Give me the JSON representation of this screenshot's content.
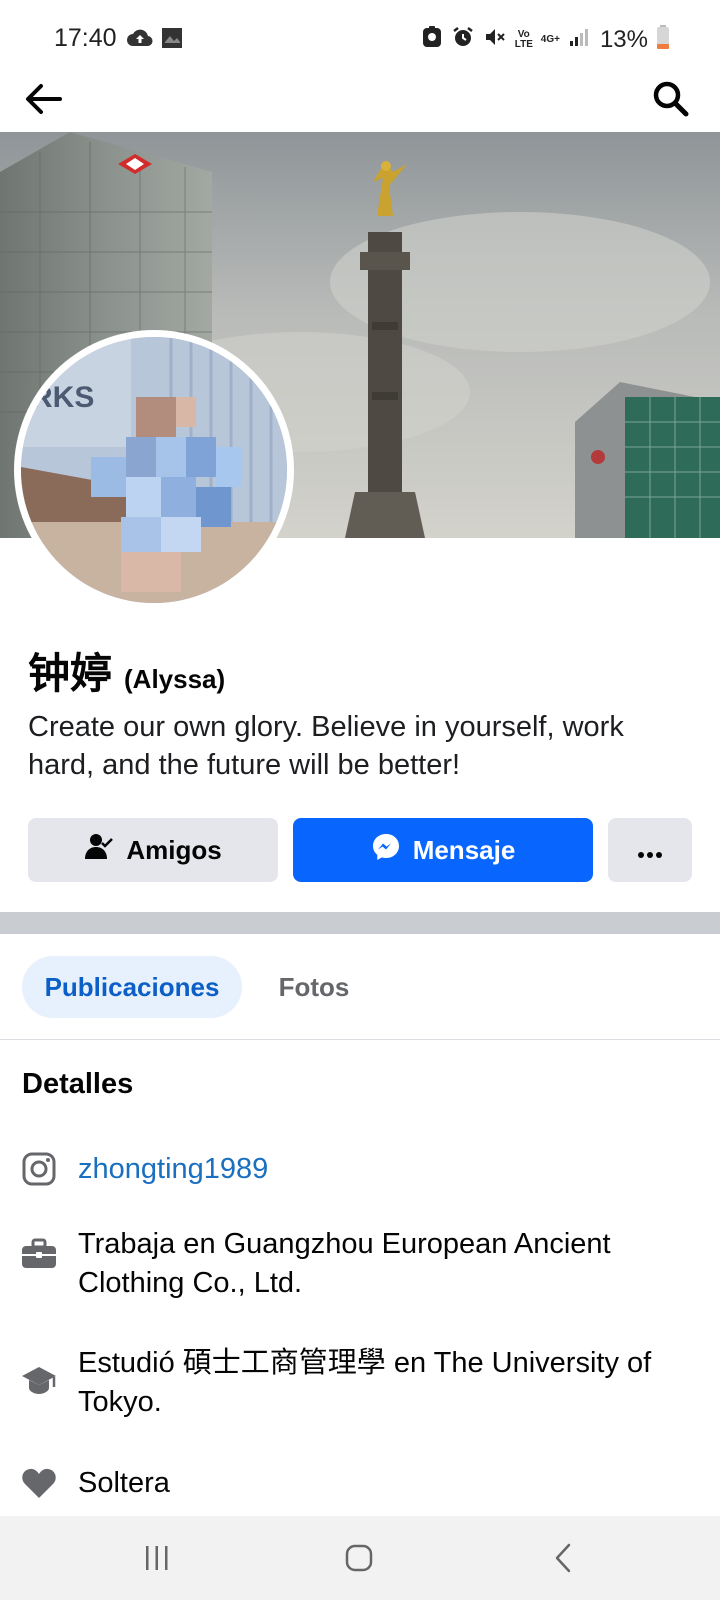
{
  "status_bar": {
    "time": "17:40",
    "battery_percent": "13%",
    "volte_label": "Vo LTE",
    "network_label": "4G+",
    "left_icons": [
      "cloud-upload-icon",
      "photo-icon"
    ],
    "right_icons": [
      "app-notification-icon",
      "alarm-icon",
      "mute-icon",
      "volte-icon",
      "network-4g-icon",
      "signal-icon",
      "battery-icon"
    ]
  },
  "app_bar": {
    "back_icon": "back-arrow-icon",
    "search_icon": "search-icon"
  },
  "profile": {
    "name": "钟婷",
    "alternate_name": "(Alyssa)",
    "bio": "Create our own glory. Believe in yourself, work hard, and the future will be better!"
  },
  "actions": {
    "friends_label": "Amigos",
    "message_label": "Mensaje",
    "more_label": "···"
  },
  "tabs": [
    {
      "label": "Publicaciones",
      "active": true
    },
    {
      "label": "Fotos",
      "active": false
    }
  ],
  "details": {
    "title": "Detalles",
    "items": [
      {
        "icon": "instagram-icon",
        "text": "zhongting1989",
        "is_link": true
      },
      {
        "icon": "briefcase-icon",
        "text": "Trabaja en Guangzhou European Ancient Clothing Co., Ltd."
      },
      {
        "icon": "graduation-cap-icon",
        "text": "Estudió 碩士工商管理學 en The University of Tokyo."
      },
      {
        "icon": "heart-icon",
        "text": "Soltera"
      }
    ]
  },
  "nav_bar": {
    "icons": [
      "recent-apps-icon",
      "home-icon",
      "back-icon"
    ]
  },
  "colors": {
    "primary_blue": "#0866ff",
    "link_blue": "#1a6fbf",
    "tab_active_bg": "#e7f0fd",
    "button_gray": "#e4e6eb"
  }
}
